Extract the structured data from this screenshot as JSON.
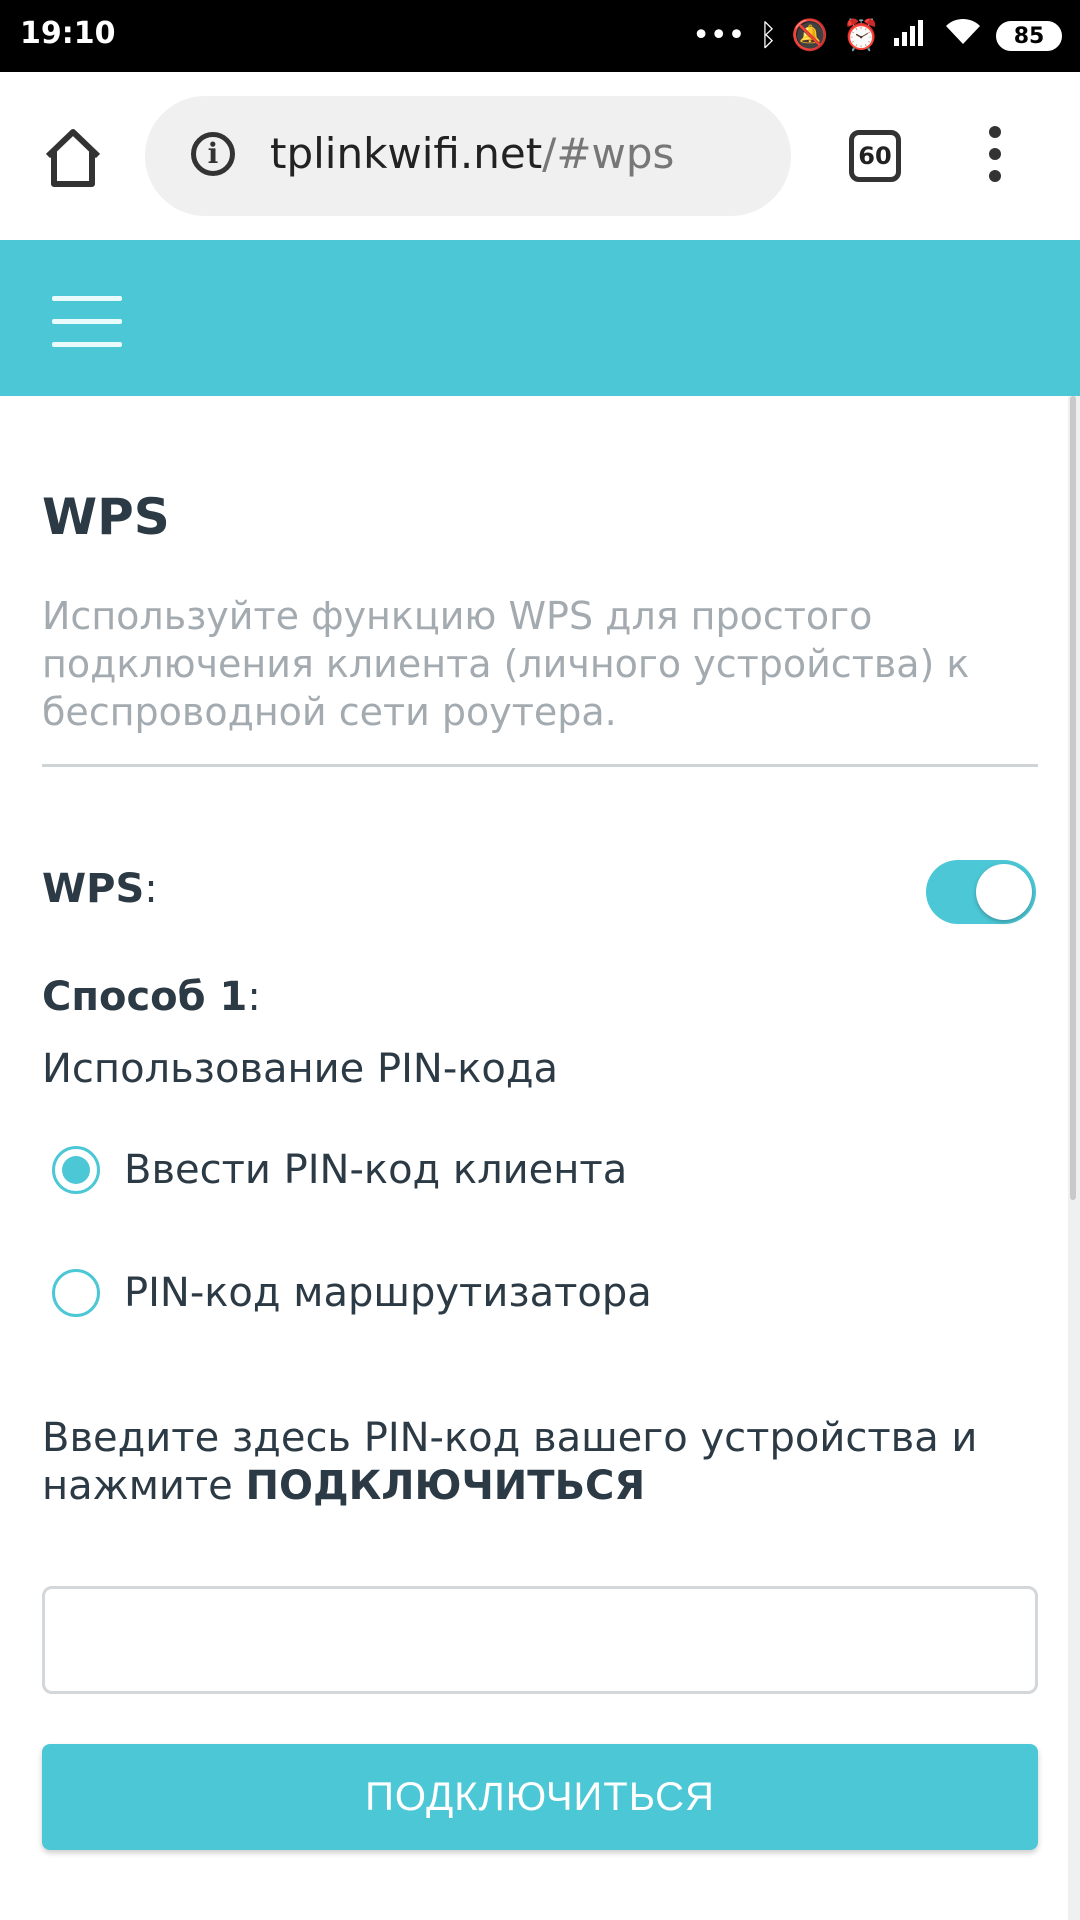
{
  "status_bar": {
    "time": "19:10",
    "battery": "85",
    "icons": [
      "more-icon",
      "bluetooth-icon",
      "mute-icon",
      "alarm-icon",
      "signal-icon",
      "wifi-icon"
    ]
  },
  "browser": {
    "url_host": "tplinkwifi.net",
    "url_path": "/#wps",
    "tab_count": "60"
  },
  "page": {
    "title": "WPS",
    "description": "Используйте функцию WPS для простого подключения клиента (личного устройства) к беспроводной сети роутера.",
    "wps_label": "WPS",
    "wps_colon": ":",
    "wps_enabled": true,
    "method_label": "Способ 1",
    "method_colon": ":",
    "method_name": "Использование PIN-кода",
    "radio_options": [
      {
        "label": "Ввести PIN-код клиента",
        "checked": true
      },
      {
        "label": "PIN-код маршрутизатора",
        "checked": false
      }
    ],
    "instruction_text": "Введите здесь PIN-код вашего устройства и нажмите ",
    "instruction_bold": "ПОДКЛЮЧИТЬСЯ",
    "pin_value": "",
    "connect_label": "ПОДКЛЮЧИТЬСЯ"
  },
  "colors": {
    "accent": "#4cc7d6",
    "text": "#2b3a44",
    "muted": "#a4abb0"
  }
}
